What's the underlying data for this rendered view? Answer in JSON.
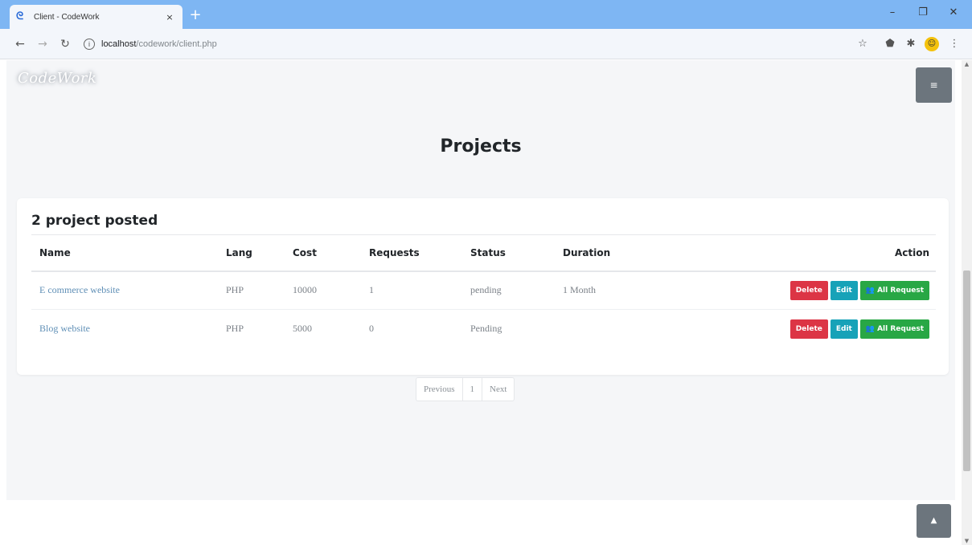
{
  "browser": {
    "tab_title": "Client - CodeWork",
    "tab_close": "×",
    "new_tab": "+",
    "controls": {
      "minimize": "–",
      "maximize": "❐",
      "close": "✕"
    },
    "url_host": "localhost",
    "url_path": "/codework/client.php"
  },
  "header": {
    "brand": "CodeWork",
    "menu_icon": "≡"
  },
  "page": {
    "title": "Projects"
  },
  "card": {
    "heading": "2 project posted",
    "columns": [
      "Name",
      "Lang",
      "Cost",
      "Requests",
      "Status",
      "Duration",
      "Action"
    ],
    "rows": [
      {
        "name": "E commerce website",
        "lang": "PHP",
        "cost": "10000",
        "requests": "1",
        "status": "pending",
        "duration": "1 Month"
      },
      {
        "name": "Blog website",
        "lang": "PHP",
        "cost": "5000",
        "requests": "0",
        "status": "Pending",
        "duration": ""
      }
    ],
    "actions": {
      "delete": "Delete",
      "edit": "Edit",
      "all_request": "All Request"
    }
  },
  "pagination": {
    "previous": "Previous",
    "current": "1",
    "next": "Next"
  },
  "colors": {
    "delete": "#dc3545",
    "edit": "#17a2b8",
    "request": "#28a745",
    "secondary": "#6c757d",
    "tabbar": "#7eb6f3"
  },
  "icons": {
    "favicon": "codework-favicon",
    "users": "users-icon",
    "menu": "hamburger-icon",
    "scroll_top": "chevron-up-icon"
  }
}
